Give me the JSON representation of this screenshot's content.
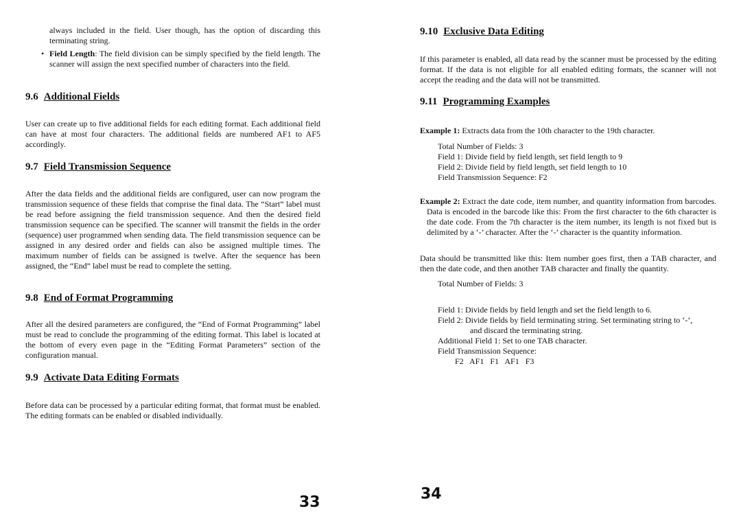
{
  "left_page": {
    "intro_continuation": "always included in the field. User though, has the option of discarding this terminating string.",
    "bullet_field_length": {
      "term": "Field Length",
      "text": ": The field division can be simply specified by the field length. The scanner will assign the next specified number of characters into the field."
    },
    "sections": [
      {
        "number": "9.6",
        "title": "Additional Fields",
        "body": "User can create up to five additional fields for each editing format. Each additional field can have at most four characters. The additional fields are numbered AF1 to AF5 accordingly."
      },
      {
        "number": "9.7",
        "title": "Field Transmission Sequence",
        "body": "After the data fields and the additional fields are configured, user can now program the transmission sequence of these fields that comprise the final data. The “Start” label must be read before assigning the field transmission sequence. And then the desired field transmission sequence can be specified. The scanner will transmit the fields in the order (sequence) user programmed when sending data. The field transmission sequence can be assigned in any desired order and fields can also be assigned multiple times. The maximum number of fields can be assigned is twelve. After the sequence has been assigned, the “End” label must be read to complete the setting."
      },
      {
        "number": "9.8",
        "title": "End of Format Programming",
        "body": "After all the desired parameters are configured, the “End of Format Programming” label must be read to conclude the programming of the editing format. This label is located at the bottom of every even page in the “Editing Format Parameters” section of the configuration manual."
      },
      {
        "number": "9.9",
        "title": "Activate Data Editing Formats",
        "body": "Before data can be processed by a particular editing format, that format must be enabled. The editing formats can be enabled or disabled individually."
      }
    ],
    "page_number": "33"
  },
  "right_page": {
    "sections": [
      {
        "number": "9.10",
        "title": "Exclusive Data Editing",
        "body": "If this parameter is enabled, all data read by the scanner must be processed by the editing format. If the data is not eligible for all enabled editing formats, the scanner will not accept the reading and the data will not be transmitted."
      },
      {
        "number": "9.11",
        "title": "Programming Examples"
      }
    ],
    "example1": {
      "label": "Example 1:",
      "text": " Extracts data from the 10th character to the 19th character.",
      "lines": [
        "Total Number of Fields: 3",
        "Field 1: Divide field by field length, set field length to 9",
        "Field 2: Divide field by field length, set field length to 10",
        "Field Transmission Sequence: F2"
      ]
    },
    "example2": {
      "label": "Example 2:",
      "text": " Extract the date code, item number, and quantity information from barcodes. Data is encoded in the barcode like this: From the first character to the 6th character is the date code. From the 7th character is the item number, its length is not fixed but is delimited by a ‘-’ character. After the ‘-’ character is the quantity information.",
      "transmit": "Data should be transmitted like this: Item number goes first, then a TAB character, and then the date code, and then another TAB character and finally the quantity.",
      "total": "Total Number of Fields: 3",
      "field1": "Field 1: Divide fields by field length and set the field length to 6.",
      "field2": "Field 2: Divide fields by field terminating string. Set terminating string to ‘-’,",
      "field2_cont": "and discard the terminating string.",
      "additional": "Additional Field 1: Set to one TAB character.",
      "sequence_label": "Field Transmission Sequence:",
      "sequence": "F2   AF1   F1   AF1   F3"
    },
    "page_number": "34"
  }
}
